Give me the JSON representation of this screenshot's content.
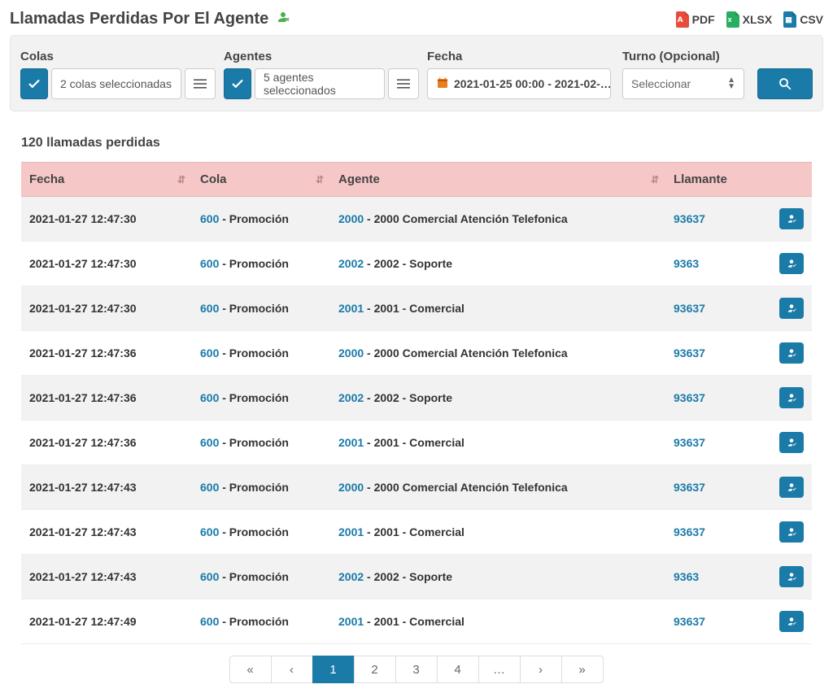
{
  "title": "Llamadas Perdidas Por El Agente",
  "export": {
    "pdf": "PDF",
    "xlsx": "XLSX",
    "csv": "CSV"
  },
  "filters": {
    "colas": {
      "label": "Colas",
      "value": "2 colas seleccionadas"
    },
    "agentes": {
      "label": "Agentes",
      "value": "5 agentes seleccionados"
    },
    "fecha": {
      "label": "Fecha",
      "value": "2021-01-25 00:00 - 2021-02-…"
    },
    "turno": {
      "label": "Turno (Opcional)",
      "value": "Seleccionar"
    }
  },
  "results_label": "120 llamadas perdidas",
  "columns": {
    "fecha": "Fecha",
    "cola": "Cola",
    "agente": "Agente",
    "llamante": "Llamante"
  },
  "rows": [
    {
      "fecha": "2021-01-27 12:47:30",
      "cola_id": "600",
      "cola_name": "Promoción",
      "agente_id": "2000",
      "agente_name": "2000 Comercial Atención Telefonica",
      "llamante": "93637"
    },
    {
      "fecha": "2021-01-27 12:47:30",
      "cola_id": "600",
      "cola_name": "Promoción",
      "agente_id": "2002",
      "agente_name": "2002 - Soporte",
      "llamante": "9363"
    },
    {
      "fecha": "2021-01-27 12:47:30",
      "cola_id": "600",
      "cola_name": "Promoción",
      "agente_id": "2001",
      "agente_name": "2001 - Comercial",
      "llamante": "93637"
    },
    {
      "fecha": "2021-01-27 12:47:36",
      "cola_id": "600",
      "cola_name": "Promoción",
      "agente_id": "2000",
      "agente_name": "2000 Comercial Atención Telefonica",
      "llamante": "93637"
    },
    {
      "fecha": "2021-01-27 12:47:36",
      "cola_id": "600",
      "cola_name": "Promoción",
      "agente_id": "2002",
      "agente_name": "2002 - Soporte",
      "llamante": "93637"
    },
    {
      "fecha": "2021-01-27 12:47:36",
      "cola_id": "600",
      "cola_name": "Promoción",
      "agente_id": "2001",
      "agente_name": "2001 - Comercial",
      "llamante": "93637"
    },
    {
      "fecha": "2021-01-27 12:47:43",
      "cola_id": "600",
      "cola_name": "Promoción",
      "agente_id": "2000",
      "agente_name": "2000 Comercial Atención Telefonica",
      "llamante": "93637"
    },
    {
      "fecha": "2021-01-27 12:47:43",
      "cola_id": "600",
      "cola_name": "Promoción",
      "agente_id": "2001",
      "agente_name": "2001 - Comercial",
      "llamante": "93637"
    },
    {
      "fecha": "2021-01-27 12:47:43",
      "cola_id": "600",
      "cola_name": "Promoción",
      "agente_id": "2002",
      "agente_name": "2002 - Soporte",
      "llamante": "9363"
    },
    {
      "fecha": "2021-01-27 12:47:49",
      "cola_id": "600",
      "cola_name": "Promoción",
      "agente_id": "2001",
      "agente_name": "2001 - Comercial",
      "llamante": "93637"
    }
  ],
  "pagination": [
    "«",
    "‹",
    "1",
    "2",
    "3",
    "4",
    "…",
    "›",
    "»"
  ],
  "active_page": "1"
}
